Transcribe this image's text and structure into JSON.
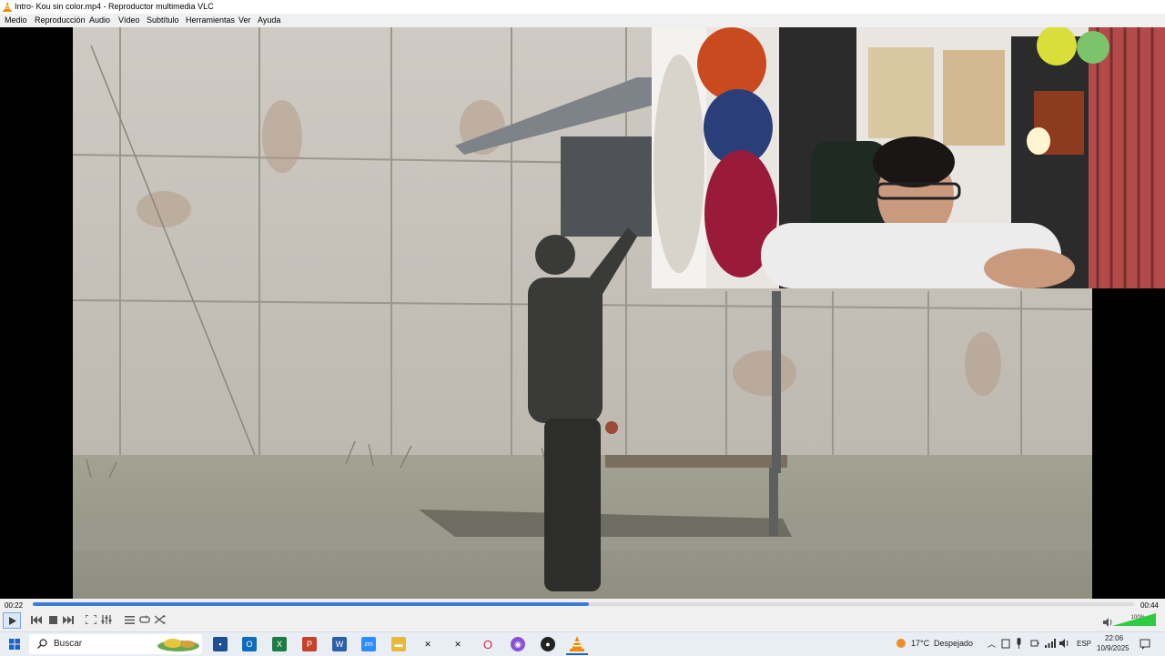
{
  "window": {
    "title": "Intro- Kou sin color.mp4 - Reproductor multimedia VLC"
  },
  "menu": [
    "Medio",
    "Reproducción",
    "Audio",
    "Vídeo",
    "Subtítulo",
    "Herramientas",
    "Ver",
    "Ayuda"
  ],
  "player": {
    "elapsed": "00:22",
    "total": "00:44",
    "progress": 0.505,
    "volume_percent": "100%",
    "volume": 1.0
  },
  "taskbar": {
    "search_placeholder": "Buscar",
    "weather_temp": "17°C",
    "weather_text": "Despejado",
    "language": "ESP",
    "clock_time": "22:06",
    "clock_date": "10/9/2025"
  },
  "colors": {
    "accent": "#3c7ed6",
    "vlc_orange": "#f08c00",
    "volume_green": "#2ecc40"
  }
}
